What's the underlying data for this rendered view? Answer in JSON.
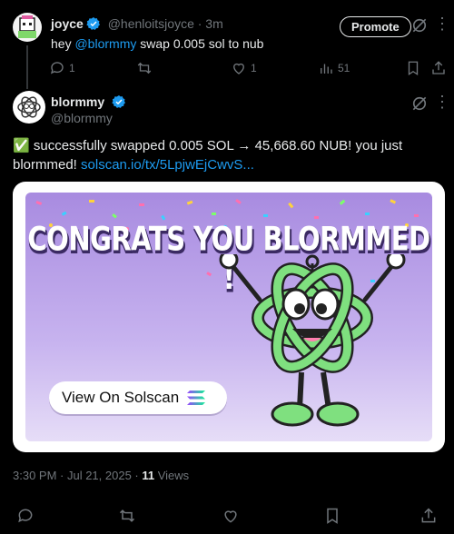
{
  "reply": {
    "author_name": "joyce",
    "author_handle": "@henloitsjoyce",
    "time": "· 3m",
    "promote_label": "Promote",
    "text_prefix": "hey ",
    "mention": "@blormmy",
    "text_suffix": " swap 0.005 sol to nub",
    "stats": {
      "replies": "1",
      "reposts": "",
      "likes": "1",
      "views": "51"
    }
  },
  "main_post": {
    "author_name": "blormmy",
    "author_handle": "@blormmy",
    "check_emoji": "✅",
    "text_body": " successfully swapped 0.005 SOL → 45,668.60 NUB! you just blormmed! ",
    "link_text": "solscan.io/tx/5LpjwEjCwvS...",
    "timestamp": "3:30 PM · Jul 21, 2025 · ",
    "views_count": "11",
    "views_label": " Views"
  },
  "card": {
    "headline": "CONGRATS YOU BLORMMED !",
    "button_label": "View On Solscan"
  },
  "colors": {
    "accent": "#1d9bf0",
    "card_purple": "#a88be0",
    "mascot_green": "#7fe07f"
  },
  "icons": [
    "reply-icon",
    "repost-icon",
    "like-icon",
    "views-icon",
    "bookmark-icon",
    "share-icon",
    "grok-icon",
    "more-icon",
    "verified-icon",
    "solana-icon"
  ]
}
